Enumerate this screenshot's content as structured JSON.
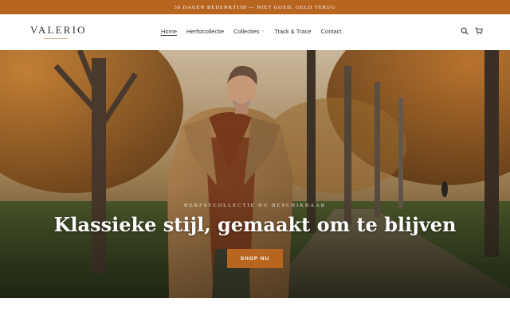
{
  "announcement": {
    "text": "30 DAGEN BEDENKTIJD — NIET GOED, GELD TERUG"
  },
  "brand": {
    "logo": "VALERIO"
  },
  "nav": {
    "items": [
      {
        "label": "Home"
      },
      {
        "label": "Herfstcollectie"
      },
      {
        "label": "Collecties"
      },
      {
        "label": "Track & Trace"
      },
      {
        "label": "Contact"
      }
    ]
  },
  "header_icons": [
    "search-icon",
    "cart-icon"
  ],
  "hero": {
    "eyebrow": "HERFSTCOLLECTIE NU BESCHIKBAAR",
    "headline": "Klassieke stijl, gemaakt om te blijven",
    "cta_label": "SHOP NU"
  },
  "colors": {
    "accent": "#b8651f",
    "header_bg": "#ffffff",
    "text": "#333333"
  }
}
